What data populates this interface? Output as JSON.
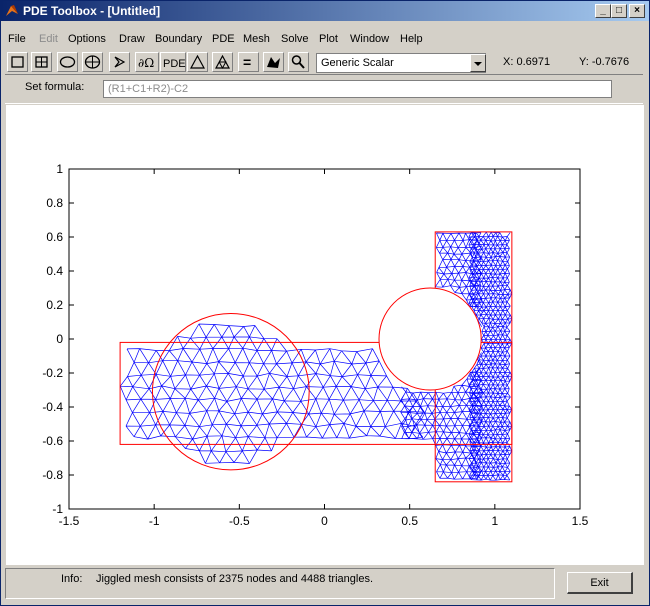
{
  "window": {
    "title": "PDE Toolbox - [Untitled]",
    "app_icon": "matlab-icon",
    "controls": [
      "minimize-icon",
      "maximize-icon",
      "close-icon"
    ]
  },
  "menu": {
    "items": [
      {
        "label": "File",
        "enabled": true
      },
      {
        "label": "Edit",
        "enabled": false
      },
      {
        "label": "Options",
        "enabled": true
      },
      {
        "label": "Draw",
        "enabled": true
      },
      {
        "label": "Boundary",
        "enabled": true
      },
      {
        "label": "PDE",
        "enabled": true
      },
      {
        "label": "Mesh",
        "enabled": true
      },
      {
        "label": "Solve",
        "enabled": true
      },
      {
        "label": "Plot",
        "enabled": true
      },
      {
        "label": "Window",
        "enabled": true
      },
      {
        "label": "Help",
        "enabled": true
      }
    ]
  },
  "toolbar": {
    "tools": [
      "rectangle-icon",
      "rectangle-centered-icon",
      "ellipse-icon",
      "ellipse-centered-icon",
      "polygon-icon",
      "boundary-mode-icon",
      "pde-spec-icon",
      "init-mesh-icon",
      "refine-mesh-icon",
      "solve-icon",
      "plot-icon",
      "zoom-icon"
    ],
    "boundary_label": "∂Ω",
    "pde_label": "PDE",
    "solve_label": "=",
    "application": {
      "selected": "Generic Scalar"
    },
    "coord_x": "X:  0.6971",
    "coord_y": "Y:  -0.7676"
  },
  "formula": {
    "label": "Set formula:",
    "value": "(R1+C1+R2)-C2"
  },
  "chart_data": {
    "type": "mesh",
    "xlim": [
      -1.5,
      1.5
    ],
    "ylim": [
      -1,
      1
    ],
    "xticks": [
      -1.5,
      -1,
      -0.5,
      0,
      0.5,
      1,
      1.5
    ],
    "xtick_labels": [
      "-1.5",
      "-1",
      "-0.5",
      "0",
      "0.5",
      "1",
      "1.5"
    ],
    "yticks": [
      -1,
      -0.8,
      -0.6,
      -0.4,
      -0.2,
      0,
      0.2,
      0.4,
      0.6,
      0.8,
      1
    ],
    "ytick_labels": [
      "-1",
      "-0.8",
      "-0.6",
      "-0.4",
      "-0.2",
      "0",
      "0.2",
      "0.4",
      "0.6",
      "0.8",
      "1"
    ],
    "mesh_color": "#0000ff",
    "boundary_color": "#ff0000",
    "shapes": {
      "R1": {
        "x": [
          -1.2,
          1.1
        ],
        "y": [
          -0.62,
          -0.02
        ]
      },
      "R2": {
        "x": [
          0.65,
          1.1
        ],
        "y": [
          -0.84,
          0.63
        ]
      },
      "C1": {
        "center": [
          -0.55,
          -0.31
        ],
        "radius": 0.46
      },
      "C2": {
        "center": [
          0.62,
          0.0
        ],
        "radius": 0.3
      }
    }
  },
  "status": {
    "label": "Info:",
    "text": "Jiggled mesh consists of 2375 nodes and 4488 triangles."
  },
  "exit_button": {
    "label": "Exit"
  }
}
